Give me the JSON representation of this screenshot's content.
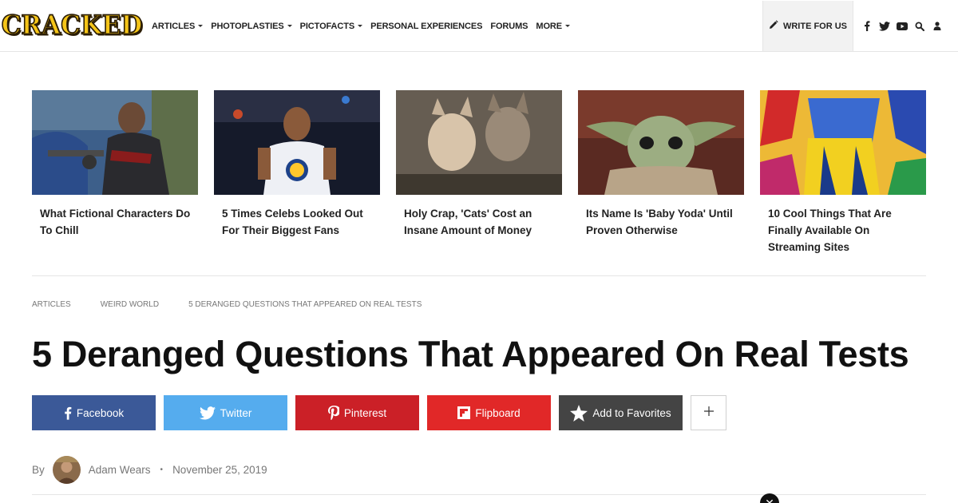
{
  "header": {
    "logo_text": "CRACKED",
    "nav": [
      {
        "label": "ARTICLES",
        "dropdown": true
      },
      {
        "label": "PHOTOPLASTIES",
        "dropdown": true
      },
      {
        "label": "PICTOFACTS",
        "dropdown": true
      },
      {
        "label": "PERSONAL EXPERIENCES",
        "dropdown": false
      },
      {
        "label": "FORUMS",
        "dropdown": false
      },
      {
        "label": "MORE",
        "dropdown": true
      }
    ],
    "write_for_us": "WRITE FOR US",
    "icons": [
      "facebook-icon",
      "twitter-icon",
      "youtube-icon",
      "search-icon",
      "user-icon"
    ]
  },
  "featured": [
    {
      "title": "What Fictional Characters Do To Chill"
    },
    {
      "title": "5 Times Celebs Looked Out For Their Biggest Fans"
    },
    {
      "title": "Holy Crap, 'Cats' Cost an Insane Amount of Money"
    },
    {
      "title": "Its Name Is 'Baby Yoda' Until Proven Otherwise"
    },
    {
      "title": "10 Cool Things That Are Finally Available On Streaming Sites"
    }
  ],
  "breadcrumb": [
    "ARTICLES",
    "WEIRD WORLD",
    "5 DERANGED QUESTIONS THAT APPEARED ON REAL TESTS"
  ],
  "article": {
    "title": "5 Deranged Questions That Appeared On Real Tests",
    "author_prefix": "By",
    "author": "Adam Wears",
    "separator": "•",
    "date": "November 25, 2019"
  },
  "share": {
    "facebook": "Facebook",
    "twitter": "Twitter",
    "pinterest": "Pinterest",
    "flipboard": "Flipboard",
    "favorites": "Add to Favorites",
    "more": "+"
  },
  "colors": {
    "facebook": "#3b5998",
    "twitter": "#55acee",
    "pinterest": "#cb2027",
    "flipboard": "#e12828",
    "favorites": "#444444",
    "logo": "#f5c518"
  }
}
